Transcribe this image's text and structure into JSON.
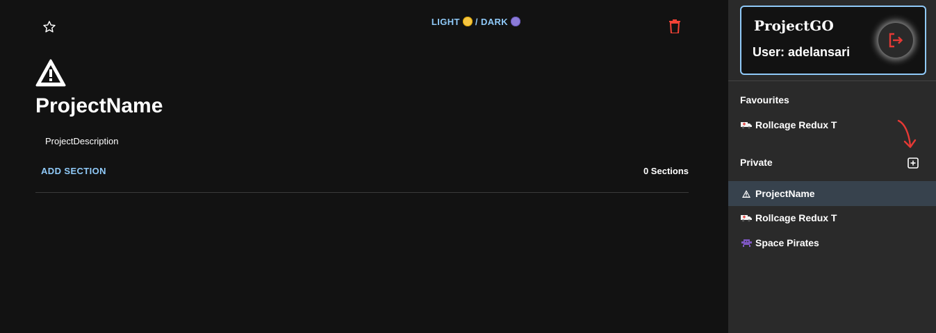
{
  "header": {
    "theme_toggle": {
      "light_label": "LIGHT",
      "separator": "/",
      "dark_label": "DARK"
    },
    "star_icon": "star-outline-icon",
    "delete_icon": "trash-icon",
    "delete_color": "#f44336"
  },
  "project": {
    "icon": "warning-icon",
    "name": "ProjectName",
    "description": "ProjectDescription",
    "add_section_label": "ADD SECTION",
    "sections_count": "0 Sections"
  },
  "profile": {
    "app_name": "ProjectGO",
    "user_label": "User: adelansari",
    "logout_icon": "logout-icon",
    "accent": "#90caf9"
  },
  "sidebar": {
    "favourites_heading": "Favourites",
    "favourites": [
      {
        "icon": "ambulance-icon",
        "label": "Rollcage Redux T"
      }
    ],
    "private_heading": "Private",
    "private_add_icon": "plus-square-icon",
    "private": [
      {
        "icon": "warning-icon",
        "label": "ProjectName",
        "active": true
      },
      {
        "icon": "ambulance-icon",
        "label": "Rollcage Redux T",
        "active": false
      },
      {
        "icon": "alien-monster-icon",
        "label": "Space Pirates",
        "active": false
      }
    ]
  },
  "colors": {
    "background": "#121212",
    "sidebar": "#2a2a2a",
    "active_item": "#37424d",
    "link": "#90caf9"
  }
}
